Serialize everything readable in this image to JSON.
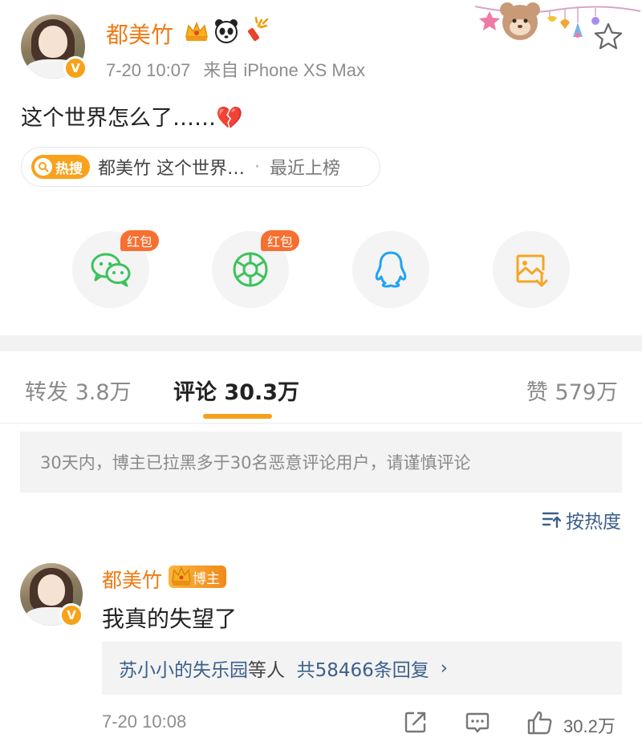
{
  "post": {
    "author": "都美竹",
    "time": "7-20 10:07",
    "source": "来自 iPhone XS Max",
    "text": "这个世界怎么了……💔",
    "badges": [
      "crown-badge",
      "panda-badge",
      "firework-badge"
    ],
    "hot_search": {
      "tag": "热搜",
      "title": "都美竹 这个世界…",
      "separator": "·",
      "status": "最近上榜"
    }
  },
  "share": {
    "targets": [
      {
        "name": "wechat",
        "badge": "红包",
        "color": "#3cc25c"
      },
      {
        "name": "moments",
        "badge": "红包",
        "color": "#3cc25c"
      },
      {
        "name": "qq",
        "badge": "",
        "color": "#1fa3f0"
      },
      {
        "name": "save-image",
        "badge": "",
        "color": "#f5a623"
      }
    ]
  },
  "tabs": [
    {
      "label": "转发",
      "count": "3.8万",
      "active": false
    },
    {
      "label": "评论",
      "count": "30.3万",
      "active": true
    },
    {
      "label": "赞",
      "count": "579万",
      "active": false
    }
  ],
  "notice": "30天内，博主已拉黑多于30名恶意评论用户，请谨慎评论",
  "sort_label": "按热度",
  "comment": {
    "author": "都美竹",
    "owner_tag": "博主",
    "text": "我真的失望了",
    "replies": {
      "names": "苏小小的失乐园",
      "suffix": "等人",
      "total": "共58466条回复",
      "chevron": "›"
    },
    "time": "7-20 10:08",
    "like_count": "30.2万"
  },
  "colors": {
    "accent_orange": "#f07b14",
    "link_blue": "#3c5f8c",
    "tab_underline": "#f5a01c",
    "hot_tag": "#f9a21c"
  }
}
